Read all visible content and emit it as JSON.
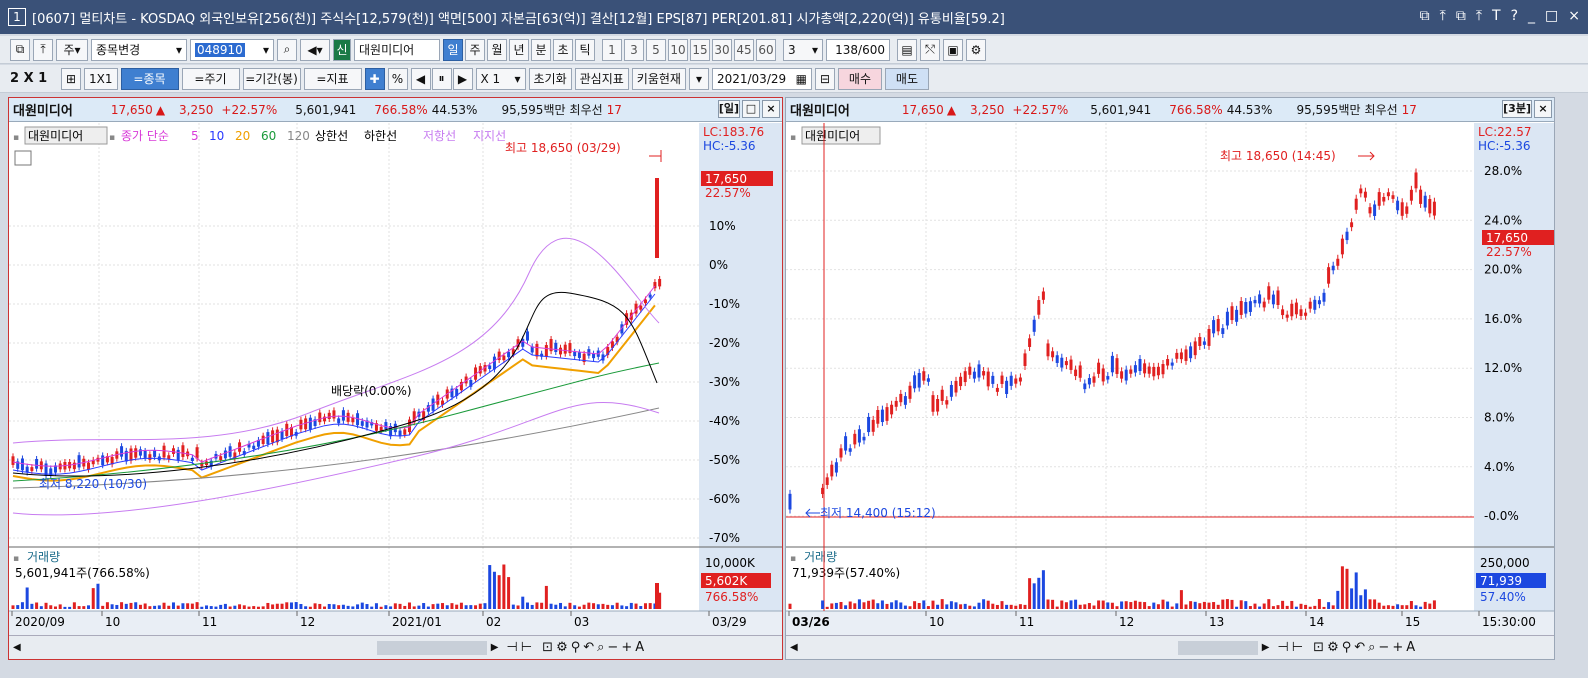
{
  "window": {
    "badge": "1",
    "title": "[0607] 멀티차트 - KOSDAQ 외국인보유[256(천)] 주식수[12,579(천)] 액면[500] 자본금[63(억)] 결산[12월] EPS[87] PER[201.81] 시가총액[2,220(억)] 유통비율[59.2]",
    "buttons": [
      "⧉",
      "⤒",
      "⧉",
      "⤒",
      "T",
      "?",
      "_",
      "□",
      "×"
    ]
  },
  "toolbar1": {
    "period_select": "주",
    "mode_select": "종목변경",
    "code_input": "048910",
    "name_badge": "신",
    "name": "대원미디어",
    "periods": [
      "일",
      "주",
      "월",
      "년",
      "분",
      "초",
      "틱"
    ],
    "active_period": "일",
    "intervals": [
      "1",
      "3",
      "5",
      "10",
      "15",
      "30",
      "45",
      "60"
    ],
    "count_select": "3",
    "page_count": "138",
    "page_total": "/600"
  },
  "toolbar2": {
    "layout": "2 X 1",
    "one_by_one": "1X1",
    "buttons": [
      "=종목",
      "=주기",
      "=기간(봉)",
      "=지표"
    ],
    "pct_btn": "%",
    "play": [
      "◀",
      "⏸",
      "▶"
    ],
    "multiplier": "X 1",
    "reset": "초기화",
    "indicators": "관심지표",
    "kiwoom": "키움현재",
    "date": "2021/03/29",
    "buy": "매수",
    "sell": "매도"
  },
  "left_panel": {
    "header": {
      "name": "대원미디어",
      "price": "17,650",
      "arrow": "▲",
      "change": "3,250",
      "rate": "+22.57%",
      "volume": "5,601,941",
      "vol_rate": "766.58%",
      "ratio": "44.53%",
      "amount": "95,595백만",
      "best": "최우선",
      "best2": "17",
      "period_tag": "[일]"
    },
    "legend": {
      "name": "대원미디어",
      "ma_title": "종가 단순",
      "ma": [
        "5",
        "10",
        "20",
        "60",
        "120"
      ],
      "upper": "상한선",
      "lower": "하한선",
      "resist": "저항선",
      "support": "지지선"
    },
    "lc": "LC:183.76",
    "hc": "HC:-5.36",
    "high_label": "최고 18,650 (03/29)",
    "low_label": "최저 8,220 (10/30)",
    "dividend_label": "배당락(0.00%)",
    "price_box": "17,650",
    "rate_label": "22.57%",
    "y_ticks": [
      "10%",
      "0%",
      "-10%",
      "-20%",
      "-30%",
      "-40%",
      "-50%",
      "-60%",
      "-70%"
    ],
    "vol_title": "거래량",
    "vol_value": "5,601,941주(766.58%)",
    "vol_ticks": [
      "10,000K"
    ],
    "vol_box": "5,602K",
    "vol_rate": "766.58%",
    "x_ticks": [
      "2020/09",
      "10",
      "11",
      "12",
      "2021/01",
      "02",
      "03",
      "03/29"
    ]
  },
  "right_panel": {
    "header": {
      "name": "대원미디어",
      "price": "17,650",
      "arrow": "▲",
      "change": "3,250",
      "rate": "+22.57%",
      "volume": "5,601,941",
      "vol_rate": "766.58%",
      "ratio": "44.53%",
      "amount": "95,595백만",
      "best": "최우선",
      "best2": "17",
      "period_tag": "[3분]"
    },
    "legend_name": "대원미디어",
    "lc": "LC:22.57",
    "hc": "HC:-5.36",
    "high_label": "최고 18,650 (14:45)",
    "low_label": "최저 14,400 (15:12)",
    "price_box": "17,650",
    "rate_label": "22.57%",
    "y_ticks": [
      "28.0%",
      "24.0%",
      "20.0%",
      "16.0%",
      "12.0%",
      "8.0%",
      "4.0%",
      "-0.0%"
    ],
    "vol_title": "거래량",
    "vol_value": "71,939주(57.40%)",
    "vol_ticks": [
      "250,000"
    ],
    "vol_box": "71,939",
    "vol_rate": "57.40%",
    "x_ticks": [
      "03/26",
      "10",
      "11",
      "12",
      "13",
      "14",
      "15",
      "15:30:00"
    ]
  },
  "colors": {
    "up": "#e02020",
    "down": "#1c48e0",
    "ma5": "#d83ad8",
    "ma10": "#2a3aff",
    "ma20": "#f0a000",
    "ma60": "#1a9a3a",
    "ma120": "#888888",
    "band": "#c77cf0"
  }
}
